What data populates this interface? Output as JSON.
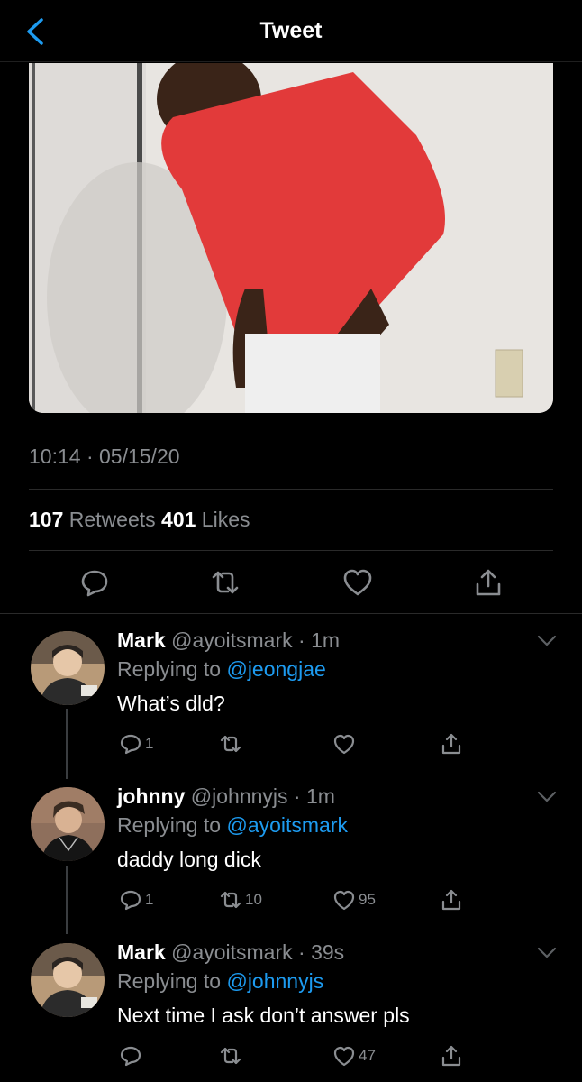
{
  "header": {
    "title": "Tweet"
  },
  "tweet": {
    "timestamp": "10:14 · 05/15/20",
    "retweets_count": "107",
    "retweets_label": "Retweets",
    "likes_count": "401",
    "likes_label": "Likes"
  },
  "replies": [
    {
      "name": "Mark",
      "handle": "@ayoitsmark",
      "time": "· 1m",
      "replying_to": "Replying to",
      "mention": "@jeongjae",
      "text": "What’s dld?",
      "reply_count": "1",
      "retweet_count": "",
      "like_count": ""
    },
    {
      "name": "johnny",
      "handle": "@johnnyjs",
      "time": "· 1m",
      "replying_to": "Replying to",
      "mention": "@ayoitsmark",
      "text": "daddy long dick",
      "reply_count": "1",
      "retweet_count": "10",
      "like_count": "95"
    },
    {
      "name": "Mark",
      "handle": "@ayoitsmark",
      "time": "· 39s",
      "replying_to": "Replying to",
      "mention": "@johnnyjs",
      "text": "Next time I ask don’t answer pls",
      "reply_count": "",
      "retweet_count": "",
      "like_count": "47"
    }
  ],
  "colors": {
    "background": "#000000",
    "text": "#ffffff",
    "muted": "#8a8d91",
    "link": "#1d9bf0",
    "accent": "#1d9bf0"
  }
}
